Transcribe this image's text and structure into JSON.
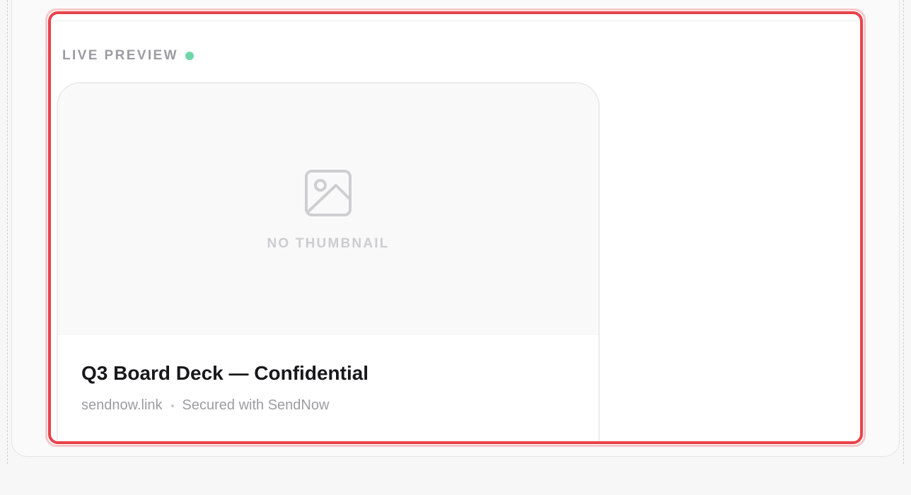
{
  "preview": {
    "section_label": "LIVE PREVIEW",
    "live_indicator_color": "#6fd7a6",
    "highlight_color": "#e8424a"
  },
  "link_card": {
    "thumbnail": {
      "icon": "image-placeholder-icon",
      "label": "NO THUMBNAIL"
    },
    "title": "Q3 Board Deck — Confidential",
    "domain": "sendnow.link",
    "security_note": "Secured with SendNow"
  }
}
